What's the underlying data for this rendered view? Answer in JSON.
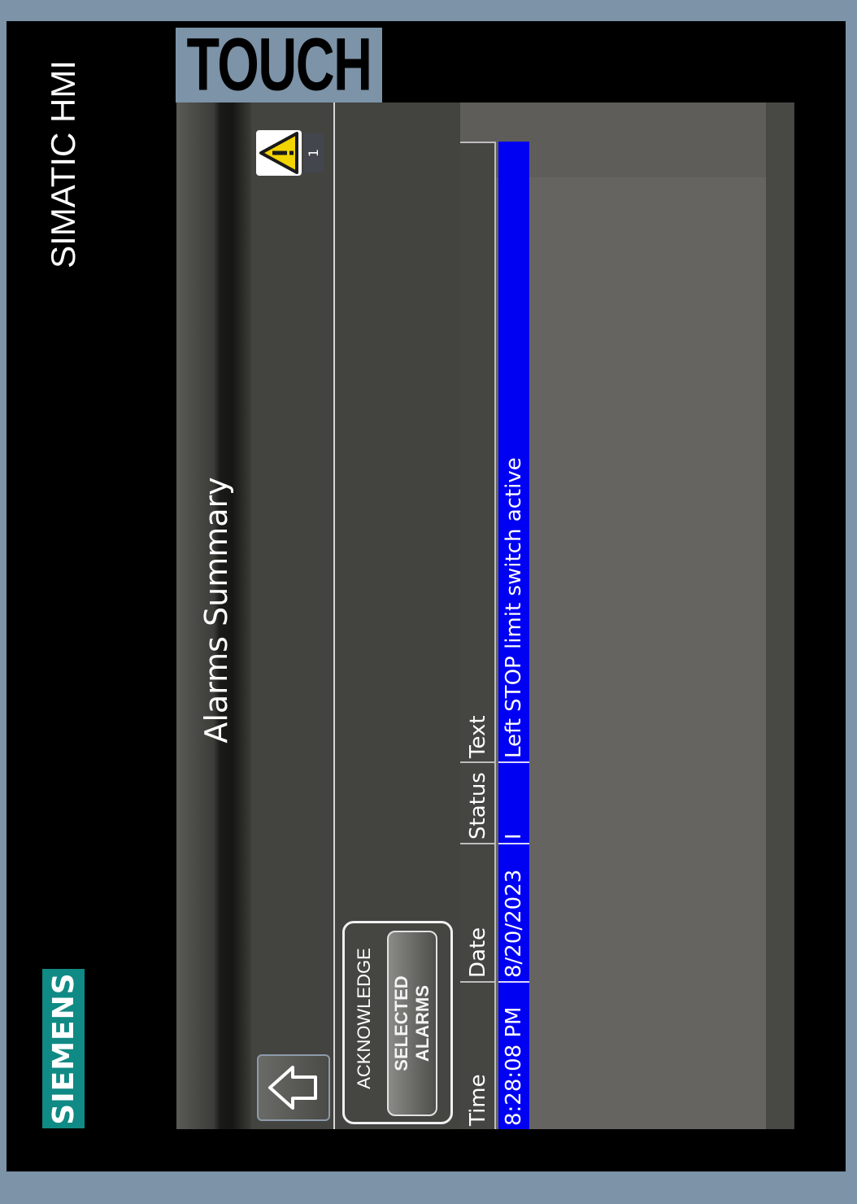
{
  "device": {
    "brand": "SIEMENS",
    "product": "SIMATIC HMI",
    "label": "TOUCH"
  },
  "header": {
    "title": "Alarms Summary",
    "home_icon": "home-icon",
    "alarm_indicator_icon": "warning-triangle-icon",
    "alarm_count": "1"
  },
  "acknowledge": {
    "group_label": "ACKNOWLEDGE",
    "button_line1": "SELECTED",
    "button_line2": "ALARMS"
  },
  "alarm_table": {
    "columns": [
      "Time",
      "Date",
      "Status",
      "Text"
    ],
    "rows": [
      {
        "time": "8:28:08 PM",
        "date": "8/20/2023",
        "status": "I",
        "text": "Left STOP limit switch active"
      }
    ]
  },
  "colors": {
    "bezel": "#000000",
    "frame": "#7c93a8",
    "brand_accent": "#0f8a84",
    "selected_row": "#0000f2",
    "panel": "#434340"
  }
}
